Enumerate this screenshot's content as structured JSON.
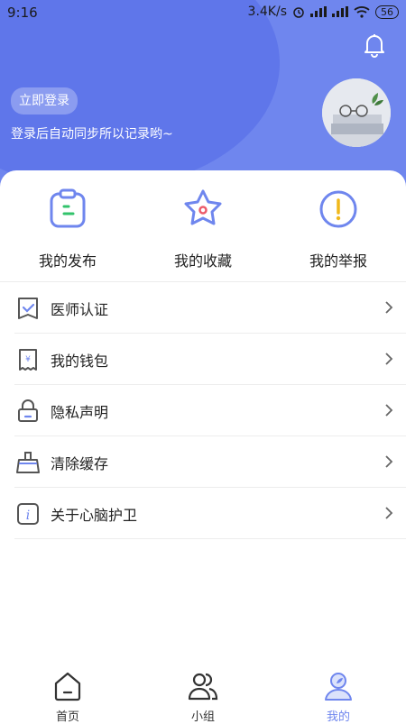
{
  "status_bar": {
    "time": "9:16",
    "speed": "3.4K/s",
    "battery": "56"
  },
  "header": {
    "login_button": "立即登录",
    "login_hint": "登录后自动同步所以记录哟~"
  },
  "quick_actions": [
    {
      "label": "我的发布",
      "icon": "clipboard-icon"
    },
    {
      "label": "我的收藏",
      "icon": "star-icon"
    },
    {
      "label": "我的举报",
      "icon": "exclamation-icon"
    }
  ],
  "menu": [
    {
      "label": "医师认证",
      "icon": "certificate-icon"
    },
    {
      "label": "我的钱包",
      "icon": "wallet-icon"
    },
    {
      "label": "隐私声明",
      "icon": "lock-icon"
    },
    {
      "label": "清除缓存",
      "icon": "broom-icon"
    },
    {
      "label": "关于心脑护卫",
      "icon": "info-icon"
    }
  ],
  "tabs": [
    {
      "label": "首页",
      "icon": "home-icon"
    },
    {
      "label": "小组",
      "icon": "group-icon"
    },
    {
      "label": "我的",
      "icon": "profile-icon"
    }
  ],
  "colors": {
    "brand": "#6f86ee",
    "icon_blue": "#6f86ee",
    "accent_green": "#32c36b",
    "accent_red": "#ec5b6a",
    "accent_yellow": "#f0b81b"
  }
}
